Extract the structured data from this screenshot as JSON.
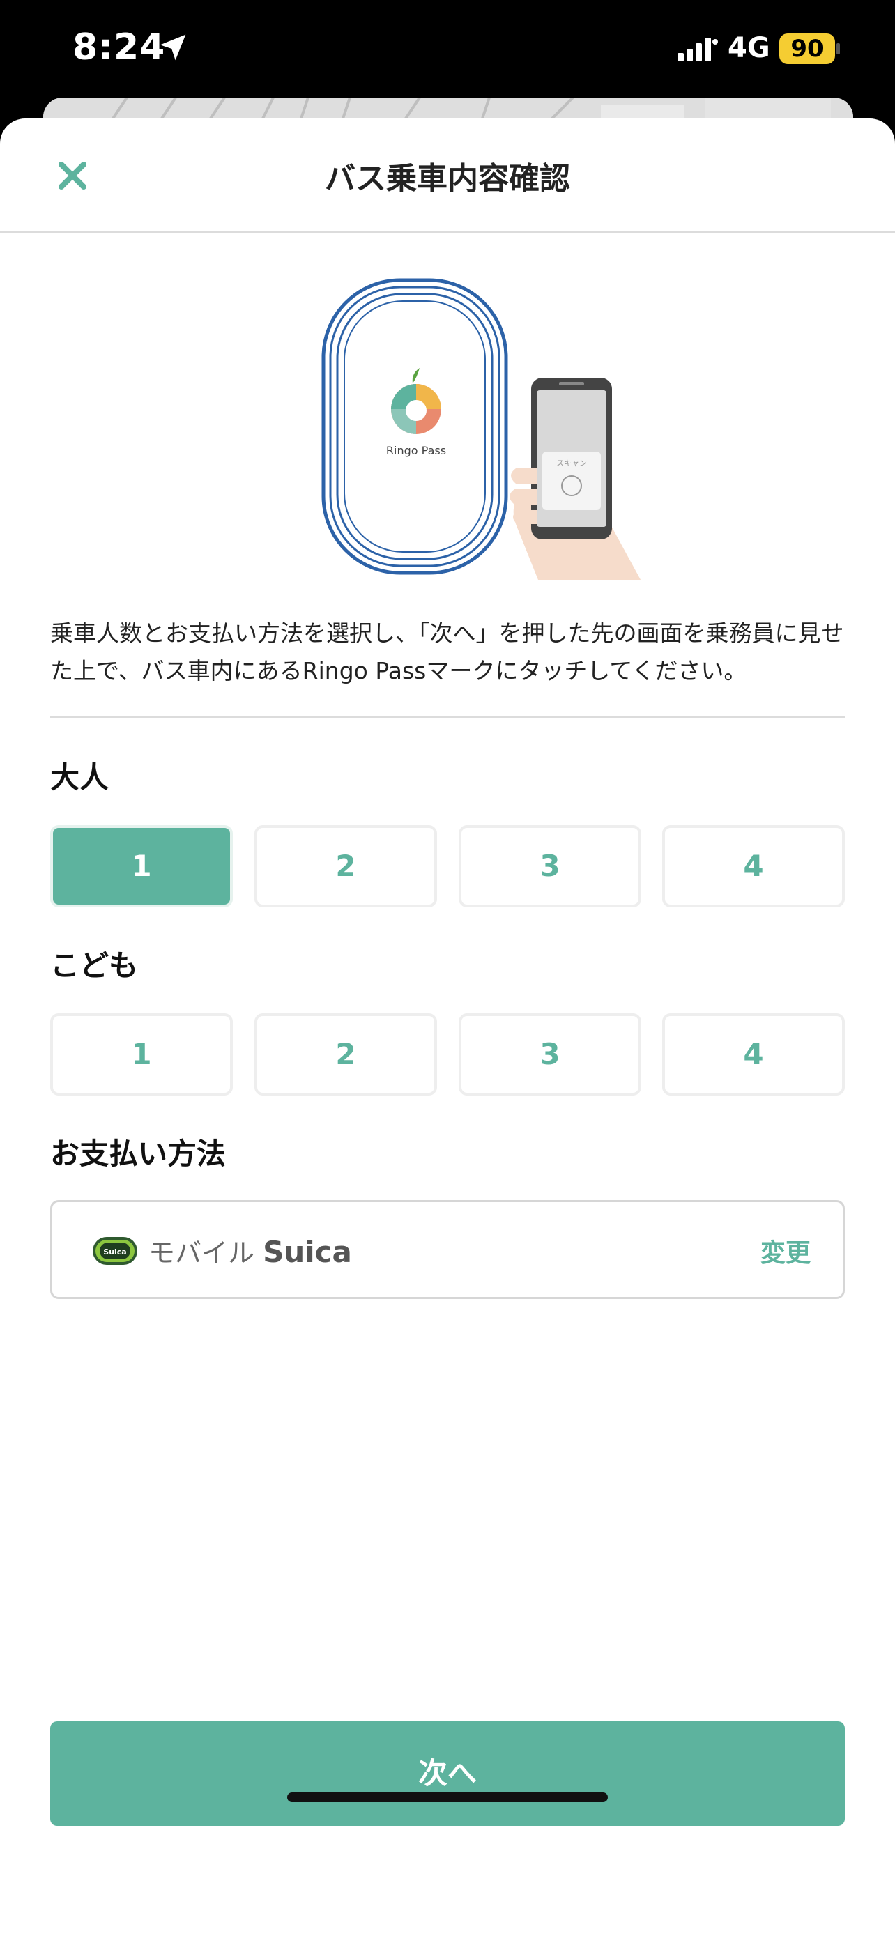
{
  "status_bar": {
    "time": "8:24",
    "network": "4G",
    "battery": "90"
  },
  "header": {
    "title": "バス乗車内容確認",
    "close_icon": "close-icon"
  },
  "illustration": {
    "brand": "Ringo Pass",
    "phone_screen_text": "スキャン"
  },
  "description": "乗車人数とお支払い方法を選択し、「次へ」を押した先の画面を乗務員に見せた上で、バス車内にあるRingo Passマークにタッチしてください。",
  "adults": {
    "label": "大人",
    "options": [
      "1",
      "2",
      "3",
      "4"
    ],
    "selected": "1"
  },
  "children": {
    "label": "こども",
    "options": [
      "1",
      "2",
      "3",
      "4"
    ],
    "selected": null
  },
  "payment": {
    "label": "お支払い方法",
    "method_prefix": "モバイル",
    "method_brand": "Suica",
    "icon": "suica-icon",
    "change_label": "変更"
  },
  "next_button": "次へ",
  "colors": {
    "accent": "#5db39e",
    "border": "#eeeeee",
    "text": "#222222"
  }
}
